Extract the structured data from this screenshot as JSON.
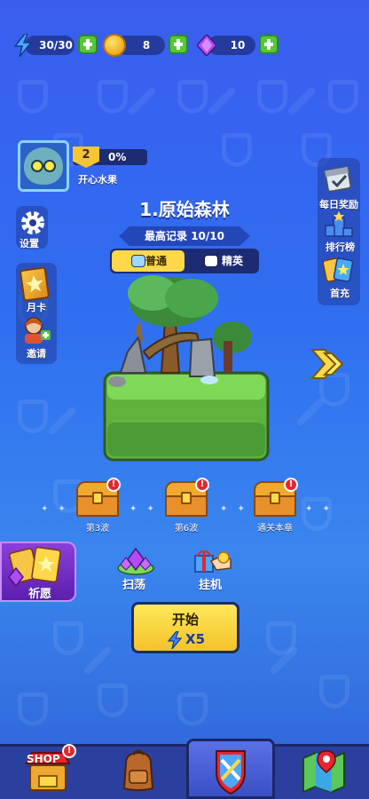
{
  "resources": {
    "energy": "30/30",
    "coins": "8",
    "gems": "10"
  },
  "player": {
    "level": "2",
    "progress": "0%",
    "progress_fraction": 0,
    "name": "开心水果"
  },
  "left_menu": {
    "settings": "设置",
    "monthly_card": "月卡",
    "invite": "邀请"
  },
  "right_menu": {
    "daily_reward": "每日奖励",
    "leaderboard": "排行榜",
    "first_recharge": "首充"
  },
  "stage": {
    "title": "1.原始森林",
    "record": "最高记录 10/10",
    "mode_normal": "普通",
    "mode_elite": "精英"
  },
  "chests": [
    {
      "label": "第3波",
      "alert": "!"
    },
    {
      "label": "第6波",
      "alert": "!"
    },
    {
      "label": "通关本章",
      "alert": "!"
    }
  ],
  "actions": {
    "wish": "祈愿",
    "sweep": "扫荡",
    "idle": "挂机"
  },
  "start": {
    "label": "开始",
    "cost": "X5"
  },
  "nav": {
    "shop": "SHOP",
    "shop_alert": "!",
    "items": [
      "shop",
      "backpack",
      "battle",
      "map"
    ],
    "active": "battle"
  },
  "colors": {
    "background": "#3a6ff0",
    "accent_yellow": "#ffd84a",
    "plus_green": "#55c73a",
    "alert_red": "#e6262e"
  }
}
